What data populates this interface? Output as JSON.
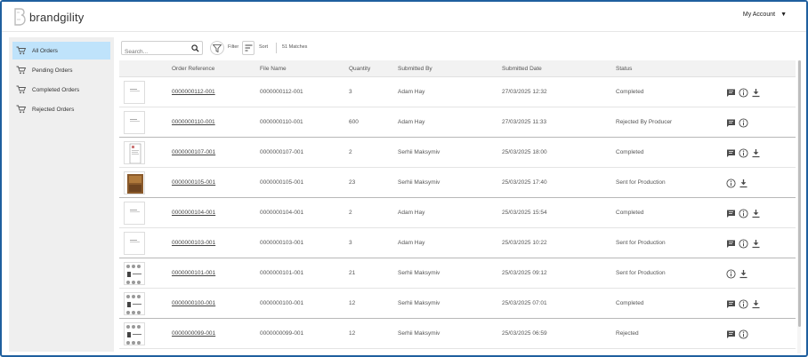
{
  "header": {
    "brand": "brandgility",
    "account_label": "My Account",
    "account_caret": "▼"
  },
  "sidebar": {
    "items": [
      {
        "label": "All Orders",
        "active": true
      },
      {
        "label": "Pending Orders",
        "active": false
      },
      {
        "label": "Completed Orders",
        "active": false
      },
      {
        "label": "Rejected Orders",
        "active": false
      }
    ]
  },
  "toolbar": {
    "search_placeholder": "Search...",
    "filter_label": "Filter",
    "sort_label": "Sort",
    "matches": "51 Matches"
  },
  "table": {
    "columns": [
      "Order Reference",
      "File Name",
      "Quantity",
      "Submitted By",
      "Submitted Date",
      "Status"
    ],
    "rows": [
      {
        "ref": "0000000112-001",
        "file": "0000000112-001",
        "qty": "3",
        "by": "Adam Hay",
        "date": "27/03/2025 12:32",
        "status": "Completed",
        "thumb": "doc",
        "actions": [
          "comment",
          "info",
          "download"
        ]
      },
      {
        "ref": "0000000110-001",
        "file": "0000000110-001",
        "qty": "600",
        "by": "Adam Hay",
        "date": "27/03/2025 11:33",
        "status": "Rejected By Producer",
        "thumb": "doc",
        "actions": [
          "comment",
          "info"
        ]
      },
      {
        "ref": "0000000107-001",
        "file": "0000000107-001",
        "qty": "2",
        "by": "Serhii Maksymiv",
        "date": "25/03/2025 18:00",
        "status": "Completed",
        "thumb": "page",
        "actions": [
          "comment",
          "info",
          "download"
        ]
      },
      {
        "ref": "0000000105-001",
        "file": "0000000105-001",
        "qty": "23",
        "by": "Serhii Maksymiv",
        "date": "25/03/2025 17:40",
        "status": "Sent for Production",
        "thumb": "photo",
        "actions": [
          "info",
          "download"
        ]
      },
      {
        "ref": "0000000104-001",
        "file": "0000000104-001",
        "qty": "2",
        "by": "Adam Hay",
        "date": "25/03/2025 15:54",
        "status": "Completed",
        "thumb": "doc",
        "actions": [
          "comment",
          "info",
          "download"
        ]
      },
      {
        "ref": "0000000103-001",
        "file": "0000000103-001",
        "qty": "3",
        "by": "Adam Hay",
        "date": "25/03/2025 10:22",
        "status": "Sent for Production",
        "thumb": "doc",
        "actions": [
          "comment",
          "info",
          "download"
        ]
      },
      {
        "ref": "0000000101-001",
        "file": "0000000101-001",
        "qty": "21",
        "by": "Serhii Maksymiv",
        "date": "25/03/2025 09:12",
        "status": "Sent for Production",
        "thumb": "pattern",
        "actions": [
          "info",
          "download"
        ]
      },
      {
        "ref": "0000000100-001",
        "file": "0000000100-001",
        "qty": "12",
        "by": "Serhii Maksymiv",
        "date": "25/03/2025 07:01",
        "status": "Completed",
        "thumb": "pattern",
        "actions": [
          "comment",
          "info",
          "download"
        ]
      },
      {
        "ref": "0000000099-001",
        "file": "0000000099-001",
        "qty": "12",
        "by": "Serhii Maksymiv",
        "date": "25/03/2025 06:59",
        "status": "Rejected",
        "thumb": "pattern",
        "actions": [
          "comment",
          "info"
        ]
      }
    ]
  },
  "colors": {
    "frame": "#1f5f9e",
    "active_nav": "#bfe3fb",
    "sidebar_bg": "#efefef"
  }
}
